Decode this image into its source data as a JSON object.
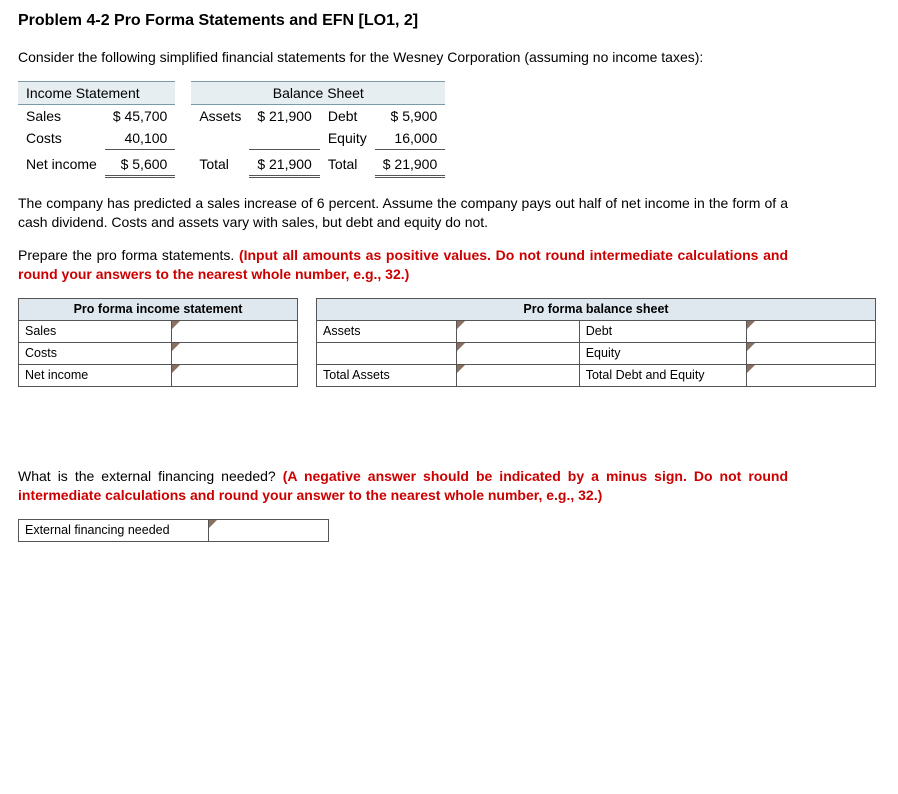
{
  "title": "Problem 4-2 Pro Forma Statements and EFN [LO1, 2]",
  "intro1": "Consider the following simplified financial statements for the Wesney Corporation (assuming no income taxes):",
  "stmt": {
    "hdr_income": "Income Statement",
    "hdr_balance": "Balance Sheet",
    "sales_lbl": "Sales",
    "sales_val": "$ 45,700",
    "costs_lbl": "Costs",
    "costs_val": "40,100",
    "ni_lbl": "Net income",
    "ni_val": "$ 5,600",
    "assets_lbl": "Assets",
    "assets_val": "$ 21,900",
    "total_lbl_l": "Total",
    "total_val_l": "$ 21,900",
    "debt_lbl": "Debt",
    "debt_val": "$ 5,900",
    "equity_lbl": "Equity",
    "equity_val": "16,000",
    "total_lbl_r": "Total",
    "total_val_r": "$ 21,900"
  },
  "para1": "The company has predicted a sales increase of 6 percent. Assume the company pays out half of net income in the form of a cash dividend. Costs and assets vary with sales, but debt and equity do not.",
  "para2a": "Prepare the pro forma statements. ",
  "para2b": "(Input all amounts as positive values. Do not round intermediate calculations and round your answers to the nearest whole number, e.g., 32.)",
  "pf_income": {
    "title": "Pro forma income statement",
    "rows": [
      "Sales",
      "Costs",
      "Net income"
    ]
  },
  "pf_balance": {
    "title": "Pro forma balance sheet",
    "left_rows": [
      "Assets",
      "",
      "Total Assets"
    ],
    "right_rows": [
      "Debt",
      "Equity",
      "Total Debt and Equity"
    ]
  },
  "para3a": "What is the external financing needed? ",
  "para3b": "(A negative answer should be indicated by a minus sign. Do not round intermediate calculations and round your answer to the nearest whole number, e.g., 32.)",
  "efn_label": "External financing needed"
}
